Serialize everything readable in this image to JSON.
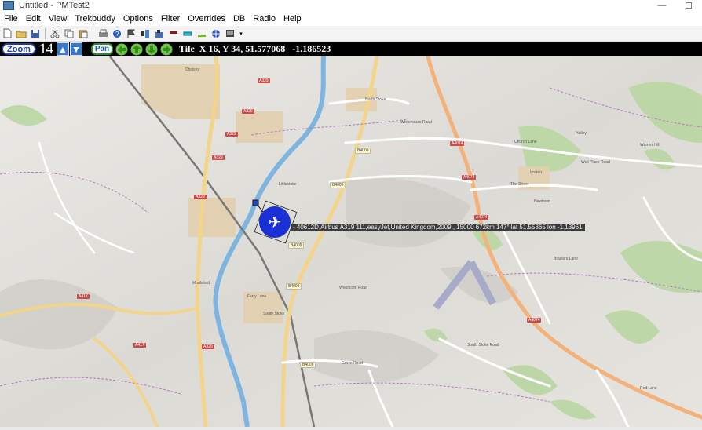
{
  "window": {
    "title": "Untitled - PMTest2",
    "minimize": "—",
    "maximize": "☐"
  },
  "menu": [
    "File",
    "Edit",
    "View",
    "Trekbuddy",
    "Options",
    "Filter",
    "Overrides",
    "DB",
    "Radio",
    "Help"
  ],
  "nav": {
    "zoom_label": "Zoom",
    "zoom_level": "14",
    "pan_label": "Pan",
    "tile_info": "Tile  X 16, Y 34, 51.577068   -1.186523"
  },
  "aircraft": {
    "tooltip": "- 40612D,Airbus A319 111,easyJet,United Kingdom,2009,, 15000 672km 147° lat 51.55865 lon -1.13961"
  },
  "map_labels": {
    "cholsey": "Cholsey",
    "north_stoke": "North Stoke",
    "little_stoke": "Littlestoke",
    "ipsden": "Ipsden",
    "newtown": "Newtown",
    "hailey": "Hailey",
    "warren_hill": "Warren Hill",
    "moulsford": "Moulsford",
    "south_stoke": "South Stoke",
    "whitehouse_road": "Whitehouse Road",
    "church_lane": "Church Lane",
    "well_place_road": "Well Place Road",
    "ferry_lane": "Ferry Lane",
    "woodcote_road": "Woodcote Road",
    "braziers_lane": "Braziers Lane",
    "south_stoke_road": "South Stoke Road",
    "grove_road": "Grove Road",
    "red_lane": "Red Lane",
    "the_street": "The Street"
  },
  "road_badges": {
    "a329_1": "A329",
    "a329_2": "A329",
    "a329_3": "A329",
    "a329_4": "A329",
    "a329_5": "A329",
    "a329_6": "A329",
    "a4074_1": "A4074",
    "a4074_2": "A4074",
    "a4074_3": "A4074",
    "a4074_4": "A4074",
    "a417_1": "A417",
    "a417_2": "A417",
    "b4009_1": "B4009",
    "b4009_2": "B4009",
    "b4009_3": "B4009",
    "b4009_4": "B4009",
    "b4009_5": "B4009"
  }
}
